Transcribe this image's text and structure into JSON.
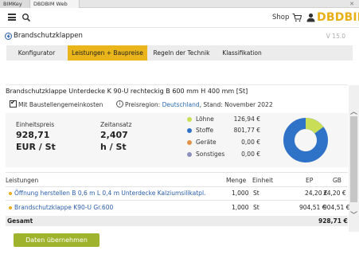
{
  "browser_tabs": [
    {
      "label": "BIMKey"
    },
    {
      "label": "DBDBIM Web"
    }
  ],
  "header": {
    "shop_label": "Shop",
    "logo_text": "DBDBIM"
  },
  "page": {
    "title": "Brandschutzklappen",
    "version": "V 15.0"
  },
  "nav_tabs": [
    {
      "label": "Konfigurator",
      "active": false
    },
    {
      "label": "Leistungen + Baupreise",
      "active": true
    },
    {
      "label": "Regeln der Technik",
      "active": false
    },
    {
      "label": "Klassifikation",
      "active": false
    }
  ],
  "product": {
    "title": "Brandschutzklappe Unterdecke K 90-U rechteckig B 600 mm H 400 mm [St]"
  },
  "options": {
    "checkbox_label": "Mit Baustellengemeinkosten",
    "checked": true,
    "region_label": "Preisregion:",
    "region_value": "Deutschland",
    "stand": ", Stand: November 2022"
  },
  "kpis": {
    "unit_price_label": "Einheitspreis",
    "unit_price_value": "928,71",
    "unit_price_unit": "EUR / St",
    "time_label": "Zeitansatz",
    "time_value": "2,407",
    "time_unit": "h / St"
  },
  "breakdown": [
    {
      "label": "Löhne",
      "value": "126,94 €",
      "color": "#c9dd57"
    },
    {
      "label": "Stoffe",
      "value": "801,77 €",
      "color": "#2f73c9"
    },
    {
      "label": "Geräte",
      "value": "0,00 €",
      "color": "#e3924a"
    },
    {
      "label": "Sonstiges",
      "value": "0,00 €",
      "color": "#8b92c0"
    }
  ],
  "table": {
    "headers": {
      "leistungen": "Leistungen",
      "menge": "Menge",
      "einheit": "Einheit",
      "ep": "EP",
      "gb": "GB"
    },
    "rows": [
      {
        "name": "Öffnung herstellen B 0,6 m L 0,4 m Unterdecke Kalziumsilikatpl.",
        "menge": "1,000",
        "einheit": "St",
        "ep": "24,20 €",
        "gb": "24,20 €"
      },
      {
        "name": "Brandschutzklappe K90-U Gr.600",
        "menge": "1,000",
        "einheit": "St",
        "ep": "904,51 €",
        "gb": "904,51 €"
      }
    ],
    "total_label": "Gesamt",
    "total_value": "928,71 €"
  },
  "cta": {
    "label": "Daten übernehmen"
  },
  "colors": {
    "accent": "#e9b51a",
    "logo": "#e8b014",
    "cta": "#9fb42c",
    "link": "#2a5ea8"
  }
}
